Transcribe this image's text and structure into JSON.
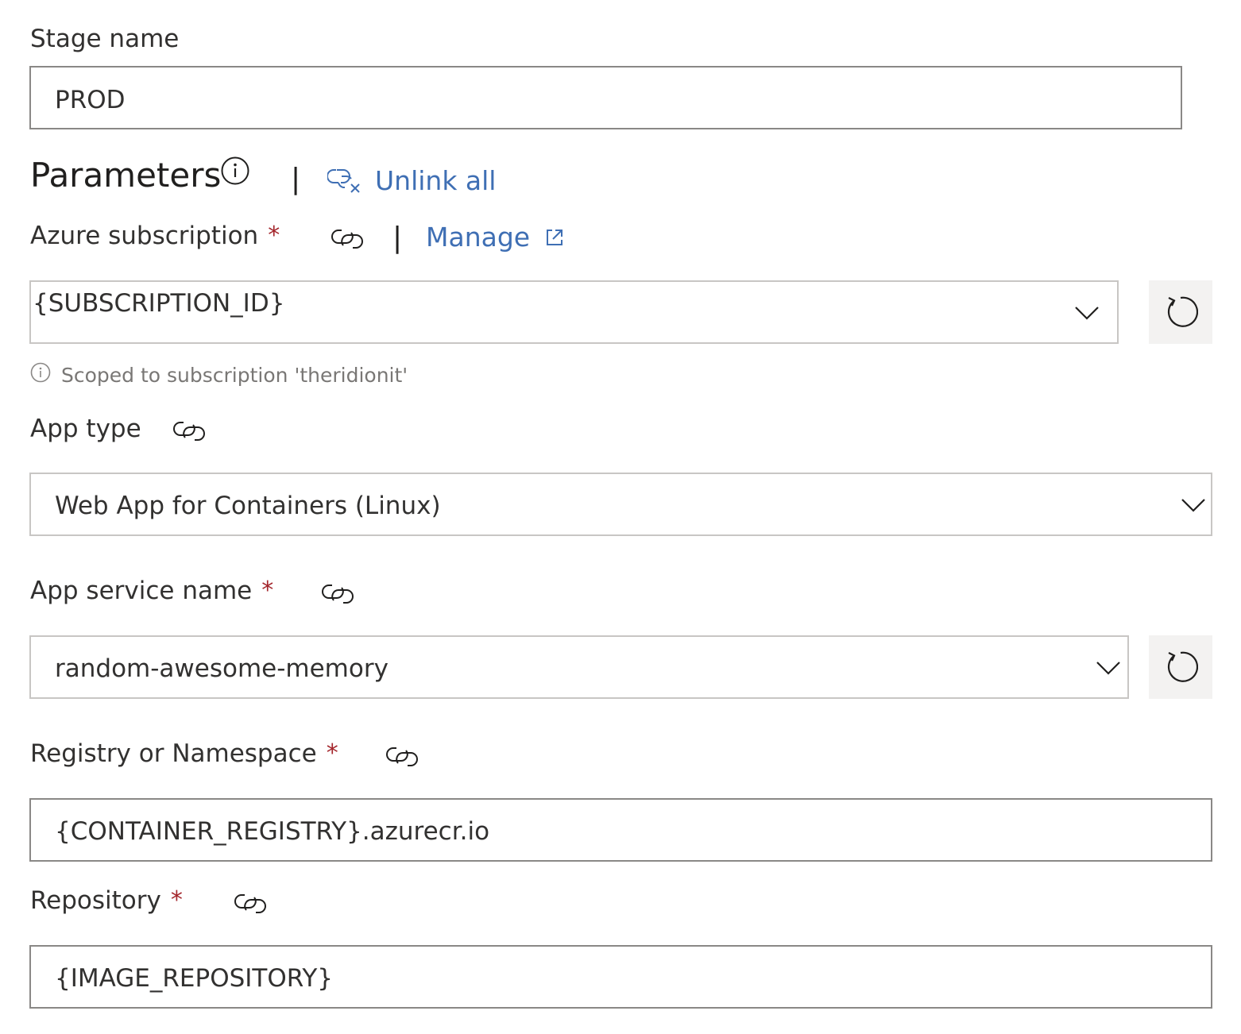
{
  "stage": {
    "label": "Stage name",
    "value": "PROD"
  },
  "parameters": {
    "title": "Parameters",
    "separator": "|",
    "unlink_all": "Unlink all"
  },
  "azure_subscription": {
    "label": "Azure subscription",
    "required": "*",
    "separator": "|",
    "manage": "Manage",
    "value": "{SUBSCRIPTION_ID}",
    "note": "Scoped to subscription 'theridionit'"
  },
  "app_type": {
    "label": "App type",
    "value": "Web App for Containers (Linux)"
  },
  "app_service": {
    "label": "App service name",
    "required": "*",
    "value": "random-awesome-memory"
  },
  "registry": {
    "label": "Registry or Namespace",
    "required": "*",
    "value": "{CONTAINER_REGISTRY}.azurecr.io"
  },
  "repository": {
    "label": "Repository",
    "required": "*",
    "value": "{IMAGE_REPOSITORY}"
  },
  "colors": {
    "link": "#3f6fb4",
    "required": "#a4262c",
    "border": "#8a8886",
    "button_bg": "#f3f2f1"
  },
  "icons": {
    "info": "info-icon",
    "link": "link-icon",
    "unlink": "unlink-icon",
    "external": "external-link-icon",
    "chevron": "chevron-down-icon",
    "refresh": "refresh-icon"
  }
}
